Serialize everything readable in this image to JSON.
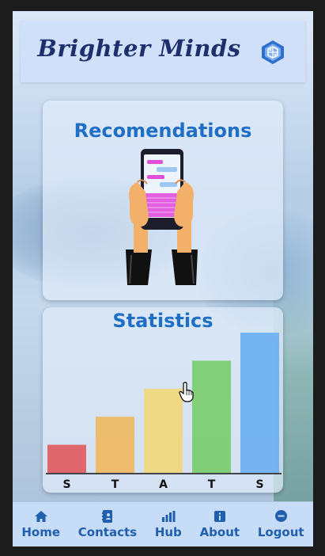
{
  "app": {
    "brand_title": "Brighter Minds",
    "logo_icon": "brain-cube-icon"
  },
  "cards": {
    "recommendations": {
      "title": "Recomendations",
      "illustration": "phone-in-hands-chat-illustration"
    },
    "statistics": {
      "title": "Statistics"
    }
  },
  "chart_data": {
    "type": "bar",
    "categories": [
      "S",
      "T",
      "A",
      "T",
      "S"
    ],
    "values": [
      1,
      2,
      3,
      4,
      5
    ],
    "colors": [
      "#e05a5e",
      "#f0b860",
      "#f2d77a",
      "#78cc6c",
      "#6aaef2"
    ],
    "ylim": [
      0,
      5
    ],
    "grid": false
  },
  "nav": {
    "items": [
      {
        "label": "Home",
        "icon": "home-icon"
      },
      {
        "label": "Contacts",
        "icon": "contacts-book-icon"
      },
      {
        "label": "Hub",
        "icon": "bar-chart-icon"
      },
      {
        "label": "About",
        "icon": "info-icon"
      },
      {
        "label": "Logout",
        "icon": "minus-circle-icon"
      }
    ]
  },
  "colors": {
    "accent": "#1f6fc6",
    "nav_bg": "#c6dcf7",
    "brand_text": "#1e2f6e"
  }
}
